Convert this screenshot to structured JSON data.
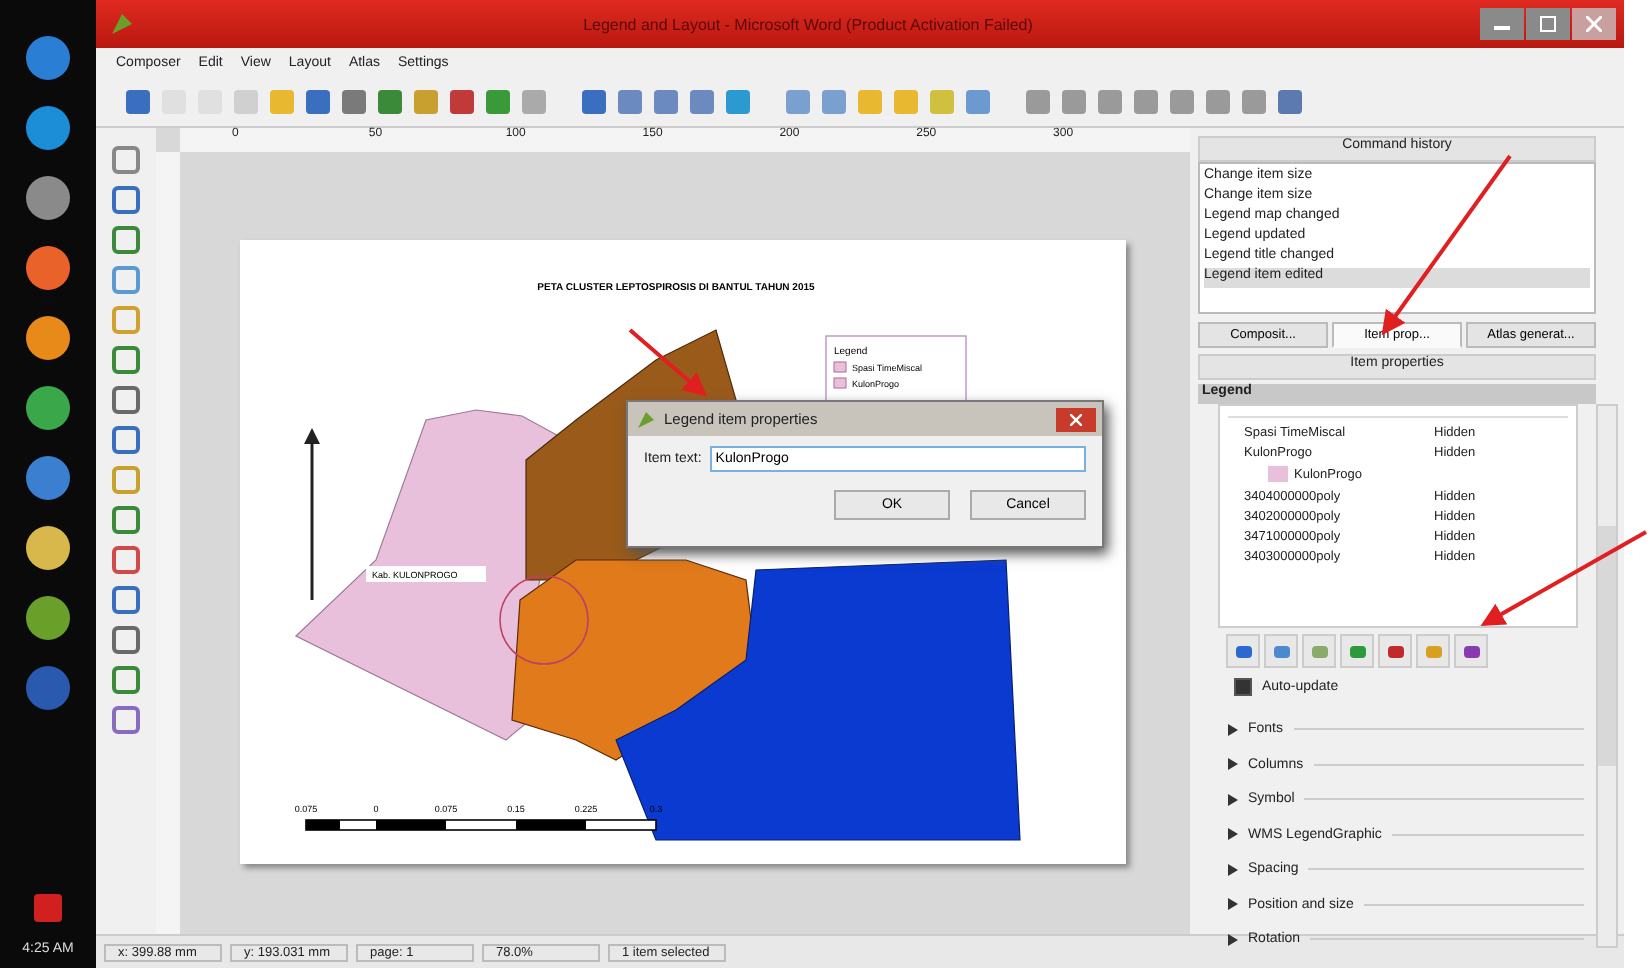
{
  "taskbar": {
    "time": "4:25 AM"
  },
  "window": {
    "title": "Legend and Layout - Microsoft Word (Product Activation Failed)"
  },
  "menu": [
    "Composer",
    "Edit",
    "View",
    "Layout",
    "Atlas",
    "Settings"
  ],
  "rulers": {
    "horizontal": [
      "0",
      "50",
      "100",
      "150",
      "200",
      "250",
      "300"
    ]
  },
  "map": {
    "title": "PETA CLUSTER LEPTOSPIROSIS DI BANTUL TAHUN 2015",
    "label": "Kab. KULONPROGO",
    "legend": {
      "title": "Legend",
      "items": [
        "Spasi TimeMiscal",
        "KulonProgo"
      ]
    },
    "scale_labels": [
      "0.075",
      "0",
      "0.075",
      "0.15",
      "0.225",
      "0.3"
    ]
  },
  "dialog": {
    "title": "Legend item properties",
    "field_label": "Item text:",
    "value": "KulonProgo",
    "buttons": [
      "OK",
      "Cancel"
    ]
  },
  "command_history": {
    "title": "Command history",
    "items": [
      {
        "label": "Change item size",
        "selected": false
      },
      {
        "label": "Change item size",
        "selected": false
      },
      {
        "label": "Legend map changed",
        "selected": false
      },
      {
        "label": "Legend updated",
        "selected": false
      },
      {
        "label": "Legend title changed",
        "selected": false
      },
      {
        "label": "Legend item edited",
        "selected": true
      }
    ]
  },
  "dock_tabs": [
    {
      "label": "Composit...",
      "selected": false
    },
    {
      "label": "Item prop...",
      "selected": true
    },
    {
      "label": "Atlas generat...",
      "selected": false
    }
  ],
  "item_properties": {
    "title": "Item properties",
    "section": "Legend",
    "legend_items": [
      {
        "label": "Spasi TimeMiscal",
        "value": "Hidden"
      },
      {
        "label": "KulonProgo",
        "value": "Hidden",
        "children": [
          {
            "label": "KulonProgo"
          }
        ]
      },
      {
        "label": "3404000000poly",
        "value": "Hidden"
      },
      {
        "label": "3402000000poly",
        "value": "Hidden"
      },
      {
        "label": "3471000000poly",
        "value": "Hidden"
      },
      {
        "label": "3403000000poly",
        "value": "Hidden"
      }
    ],
    "auto_update": {
      "label": "Auto-update",
      "checked": true
    },
    "groups": [
      {
        "label": "Fonts",
        "expanded": false
      },
      {
        "label": "Columns",
        "expanded": false
      },
      {
        "label": "Symbol",
        "expanded": false
      },
      {
        "label": "WMS LegendGraphic",
        "expanded": false
      },
      {
        "label": "Spacing",
        "expanded": false
      },
      {
        "label": "Position and size",
        "expanded": false
      },
      {
        "label": "Rotation",
        "expanded": false
      }
    ]
  },
  "status_bar": [
    "x: 399.88 mm",
    "y: 193.031 mm",
    "page: 1",
    "78.0%",
    "1 item selected"
  ]
}
